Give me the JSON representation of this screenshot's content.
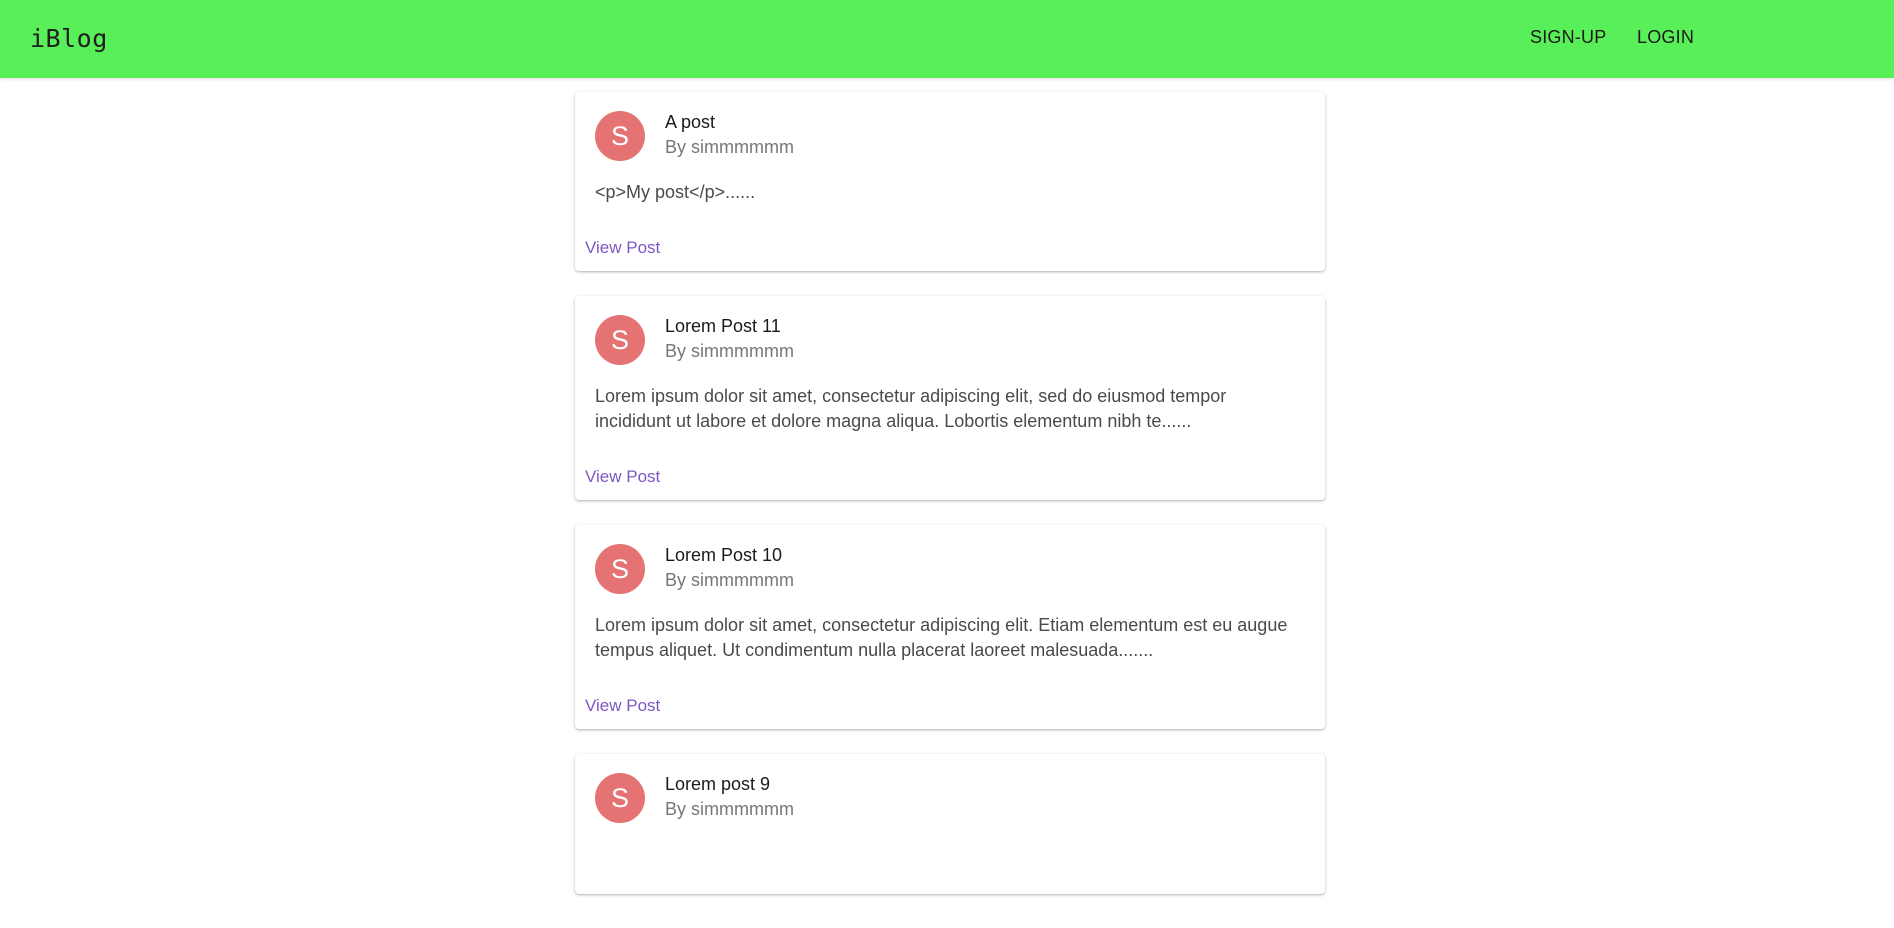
{
  "app": {
    "brand": "iBlog",
    "nav": {
      "signup_label": "SIGN-UP",
      "login_label": "LOGIN"
    },
    "colors": {
      "appbar": "#58ef58",
      "avatar": "#e57373",
      "link": "#7e57c2"
    }
  },
  "posts": [
    {
      "avatar_letter": "S",
      "title": "A post",
      "author": "By simmmmmm",
      "excerpt": "<p>My post</p>......",
      "action_label": "View Post"
    },
    {
      "avatar_letter": "S",
      "title": "Lorem Post 11",
      "author": "By simmmmmm",
      "excerpt": "Lorem ipsum dolor sit amet, consectetur adipiscing elit, sed do eiusmod tempor incididunt ut labore et dolore magna aliqua. Lobortis elementum nibh te......",
      "action_label": "View Post"
    },
    {
      "avatar_letter": "S",
      "title": "Lorem Post 10",
      "author": "By simmmmmm",
      "excerpt": "Lorem ipsum dolor sit amet, consectetur adipiscing elit. Etiam elementum est eu augue tempus aliquet. Ut condimentum nulla placerat laoreet malesuada.......",
      "action_label": "View Post"
    },
    {
      "avatar_letter": "S",
      "title": "Lorem post 9",
      "author": "By simmmmmm"
    }
  ]
}
